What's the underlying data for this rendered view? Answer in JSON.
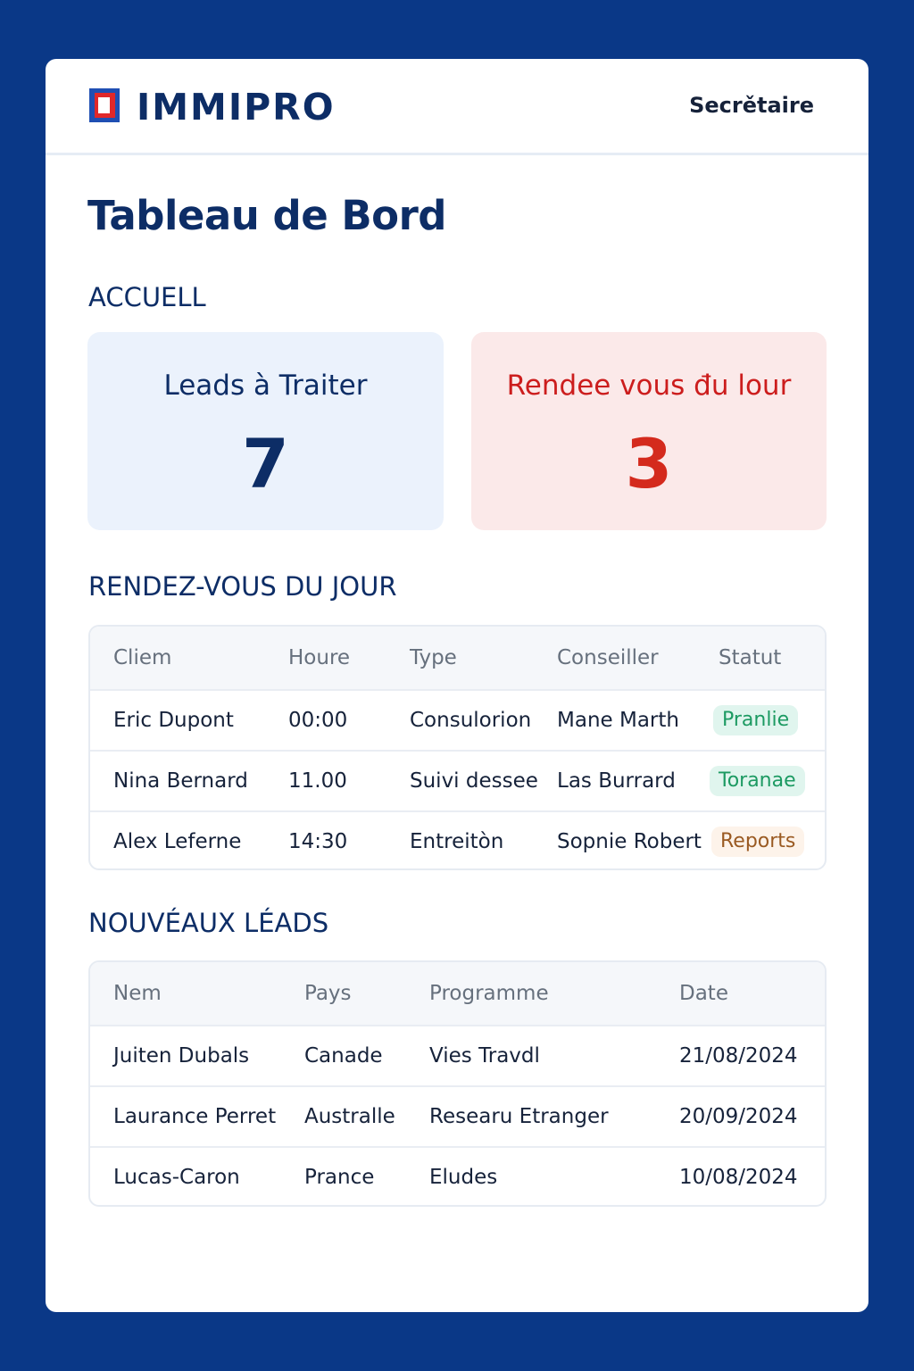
{
  "header": {
    "brand": "IMMIPRO",
    "role": "Secrětaire",
    "colors": {
      "brand_navy": "#0d2d66",
      "logo_blue": "#1f4fb3",
      "logo_red": "#e0282a"
    }
  },
  "page_title": "Tableau de Bord",
  "sections": {
    "accueil": "ACCUELL",
    "rdv": "RENDEZ-VOUS DU JOUR",
    "leads": "NOUVÉAUX LÉADS"
  },
  "stats": [
    {
      "label": "Leads à Traiter",
      "value": "7",
      "color": "#0d2d66"
    },
    {
      "label": "Rendee vous đu lour",
      "value": "3",
      "color": "#d42a1d"
    }
  ],
  "appointments": {
    "columns": [
      "Cliem",
      "Houre",
      "Type",
      "Conseiller",
      "Statut"
    ],
    "rows": [
      {
        "client": "Eric Dupont",
        "hour": "00:00",
        "type": "Consulorion",
        "advisor": "Mane Marth",
        "status": "Pranlie",
        "status_color": "green"
      },
      {
        "client": "Nina Bernard",
        "hour": "11.00",
        "type": "Suivi dessee",
        "advisor": "Las Burrard",
        "status": "Toranae",
        "status_color": "green"
      },
      {
        "client": "Alex Leferne",
        "hour": "14:30",
        "type": "Entreitòn",
        "advisor": "Sopnie Robert",
        "status": "Reports",
        "status_color": "orange"
      }
    ]
  },
  "leads": {
    "columns": [
      "Nem",
      "Pays",
      "Programme",
      "Date"
    ],
    "rows": [
      {
        "name": "Juiten Dubals",
        "country": "Canade",
        "program": "Vies Travdl",
        "date": "21/08/2024"
      },
      {
        "name": "Laurance Perret",
        "country": "Australle",
        "program": "Researu Etranger",
        "date": "20/09/2024"
      },
      {
        "name": "Lucas-Caron",
        "country": "Prance",
        "program": "Eludes",
        "date": "10/08/2024"
      }
    ]
  }
}
